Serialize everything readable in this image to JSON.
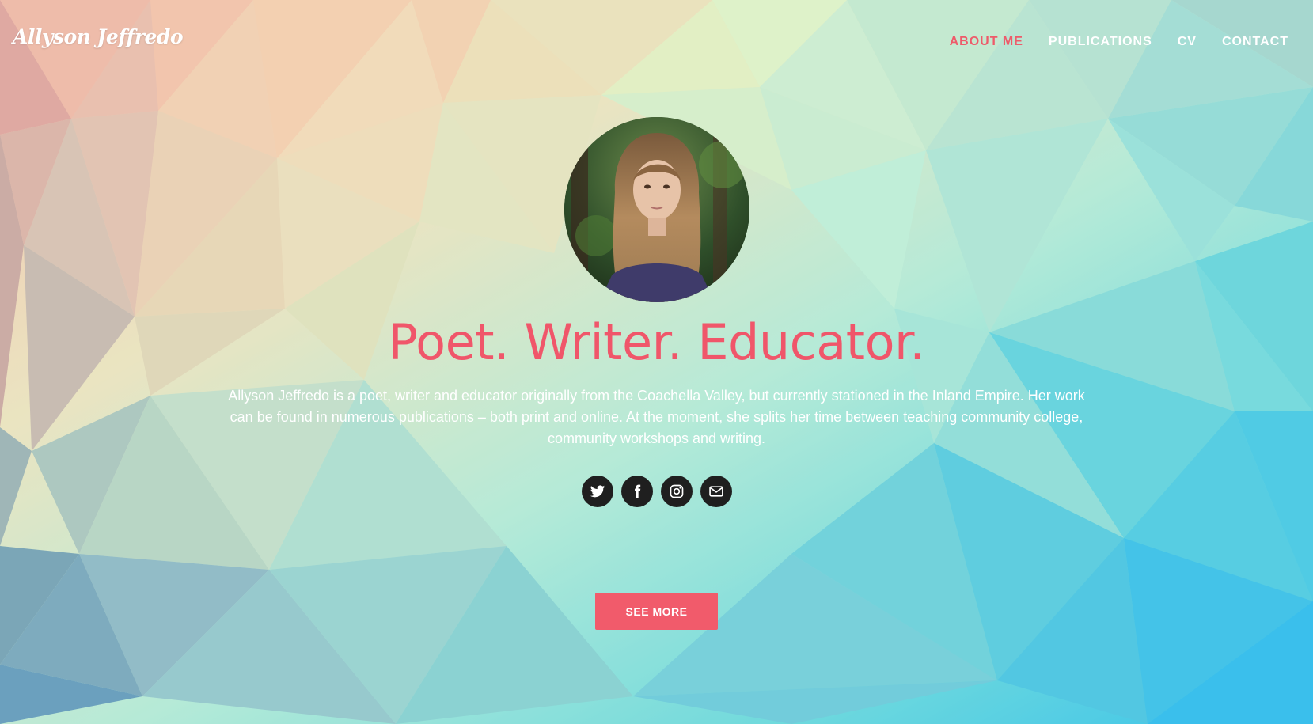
{
  "brand": {
    "name": "Allyson Jeffredo"
  },
  "nav": {
    "items": [
      {
        "label": "ABOUT ME",
        "active": true
      },
      {
        "label": "PUBLICATIONS",
        "active": false
      },
      {
        "label": "CV",
        "active": false
      },
      {
        "label": "CONTACT",
        "active": false
      }
    ]
  },
  "hero": {
    "headline": "Poet. Writer. Educator.",
    "bio": "Allyson Jeffredo is a poet, writer and educator originally from the Coachella Valley, but currently stationed in the Inland Empire. Her work can be found in numerous publications – both print and online. At the moment, she splits her time between teaching community college, community workshops and writing.",
    "cta_label": "SEE MORE"
  },
  "social": [
    {
      "name": "twitter-icon"
    },
    {
      "name": "facebook-icon"
    },
    {
      "name": "instagram-icon"
    },
    {
      "name": "envelope-icon"
    }
  ],
  "colors": {
    "accent": "#f15b6b",
    "headline": "#f0566a",
    "social_bg": "#1f1f1f",
    "text": "#ffffff"
  }
}
